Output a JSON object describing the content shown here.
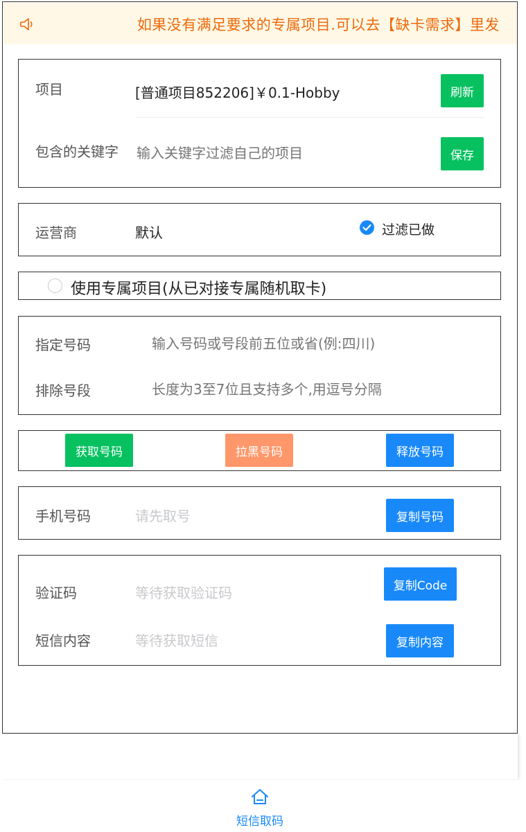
{
  "notice": {
    "text": "如果没有满足要求的专属项目.可以去【缺卡需求】里发",
    "icon": "volume-icon"
  },
  "project": {
    "label": "项目",
    "value": "[普通项目852206]￥0.1-Hobby",
    "refresh_label": "刷新",
    "keyword_label": "包含的关键字",
    "keyword_placeholder": "输入关键字过滤自己的项目",
    "save_label": "保存"
  },
  "operator": {
    "label": "运营商",
    "value": "默认",
    "filter_label": "过滤已做",
    "filter_checked": true
  },
  "exclusive": {
    "label": "使用专属项目(从已对接专属随机取卡)",
    "checked": false
  },
  "numbers": {
    "assign_label": "指定号码",
    "assign_placeholder": "输入号码或号段前五位或省(例:四川)",
    "exclude_label": "排除号段",
    "exclude_placeholder": "长度为3至7位且支持多个,用逗号分隔"
  },
  "actions": {
    "get_label": "获取号码",
    "block_label": "拉黑号码",
    "release_label": "释放号码"
  },
  "phone": {
    "label": "手机号码",
    "placeholder": "请先取号",
    "copy_label": "复制号码"
  },
  "sms": {
    "code_label": "验证码",
    "code_placeholder": "等待获取验证码",
    "copy_code_label": "复制Code",
    "content_label": "短信内容",
    "content_placeholder": "等待获取短信",
    "copy_content_label": "复制内容"
  },
  "tabbar": {
    "tab_label": "短信取码",
    "tab_icon": "home-icon"
  },
  "colors": {
    "green": "#07c160",
    "blue": "#1989fa",
    "orange": "#ff976a",
    "notice_text": "#ed6a0c",
    "notice_bg": "#fff8e6"
  }
}
